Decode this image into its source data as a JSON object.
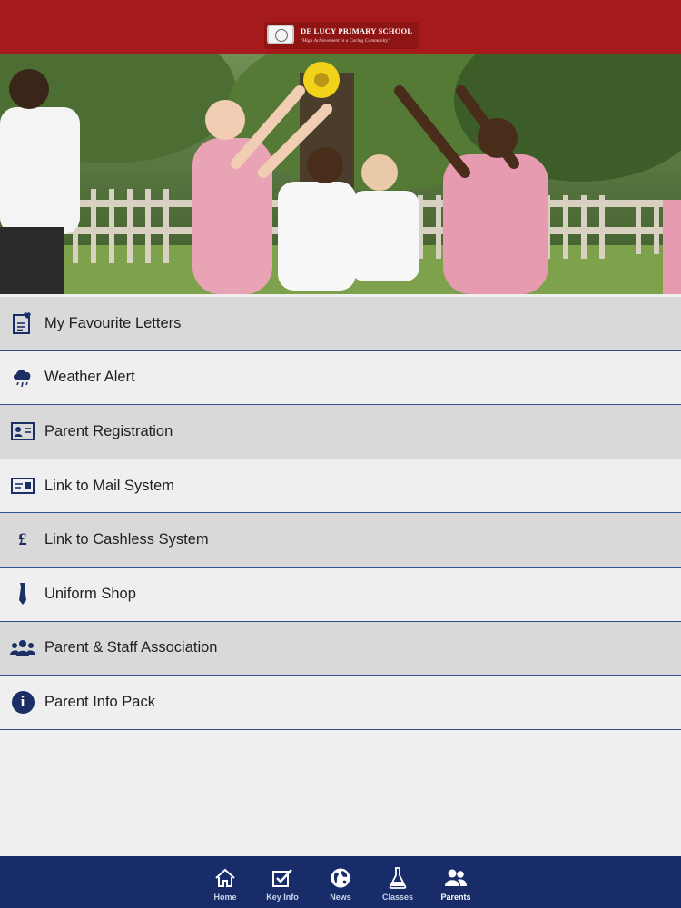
{
  "header": {
    "school_name": "DE LUCY PRIMARY SCHOOL",
    "tagline": "\"High Achievement in a Caring Community\"",
    "brand_color": "#a51b1b"
  },
  "menu": {
    "items": [
      {
        "label": "My Favourite Letters",
        "icon": "letter-heart-icon"
      },
      {
        "label": "Weather Alert",
        "icon": "rain-cloud-icon"
      },
      {
        "label": "Parent Registration",
        "icon": "id-card-icon"
      },
      {
        "label": "Link to Mail System",
        "icon": "mail-card-icon"
      },
      {
        "label": "Link to Cashless System",
        "icon": "pound-icon",
        "glyph": "£"
      },
      {
        "label": "Uniform Shop",
        "icon": "tie-icon"
      },
      {
        "label": "Parent & Staff Association",
        "icon": "group-icon"
      },
      {
        "label": "Parent Info Pack",
        "icon": "info-icon",
        "glyph": "i"
      }
    ],
    "divider_color": "#2f4f8a",
    "icon_color": "#1b2f66"
  },
  "tabbar": {
    "background": "#172c69",
    "tabs": [
      {
        "label": "Home",
        "icon": "home-icon"
      },
      {
        "label": "Key Info",
        "icon": "checkbox-icon"
      },
      {
        "label": "News",
        "icon": "globe-icon"
      },
      {
        "label": "Classes",
        "icon": "flask-icon"
      },
      {
        "label": "Parents",
        "icon": "parents-icon",
        "active": true
      }
    ]
  }
}
